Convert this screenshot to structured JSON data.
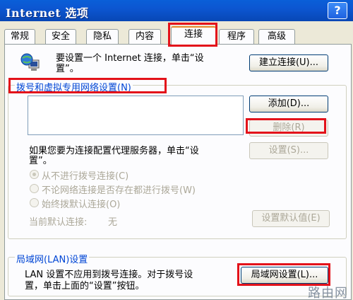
{
  "window": {
    "title": "Internet 选项",
    "help": "?"
  },
  "tabs": [
    "常规",
    "安全",
    "隐私",
    "内容",
    "连接",
    "程序",
    "高级"
  ],
  "connect": {
    "intro_line1": "要设置一个 Internet 连接，单击“设",
    "intro_line2": "置”。",
    "setup_button": "建立连接(U)..."
  },
  "dialup": {
    "group_title": "拨号和虚拟专用网络设置(N)",
    "add_button": "添加(D)...",
    "remove_button": "删除(R)",
    "proxy_text_line1": "如果您要为连接配置代理服务器，单击“设",
    "proxy_text_line2": "置”。",
    "settings_button": "设置(S)...",
    "radio_never": "从不进行拨号连接(C)",
    "radio_when_absent": "不论网络连接是否存在都进行拨号(W)",
    "radio_always": "始终拨默认连接(O)",
    "current_default_label": "当前默认连接:",
    "current_default_value": "无",
    "set_default_button": "设置默认值(E)"
  },
  "lan": {
    "group_title": "局域网(LAN)设置",
    "text_line1": "LAN 设置不应用到拨号连接。对于拨号设",
    "text_line2": "置，单击上面的“设置”按钮。",
    "lan_settings_button": "局域网设置(L)..."
  },
  "watermark": "路由网"
}
